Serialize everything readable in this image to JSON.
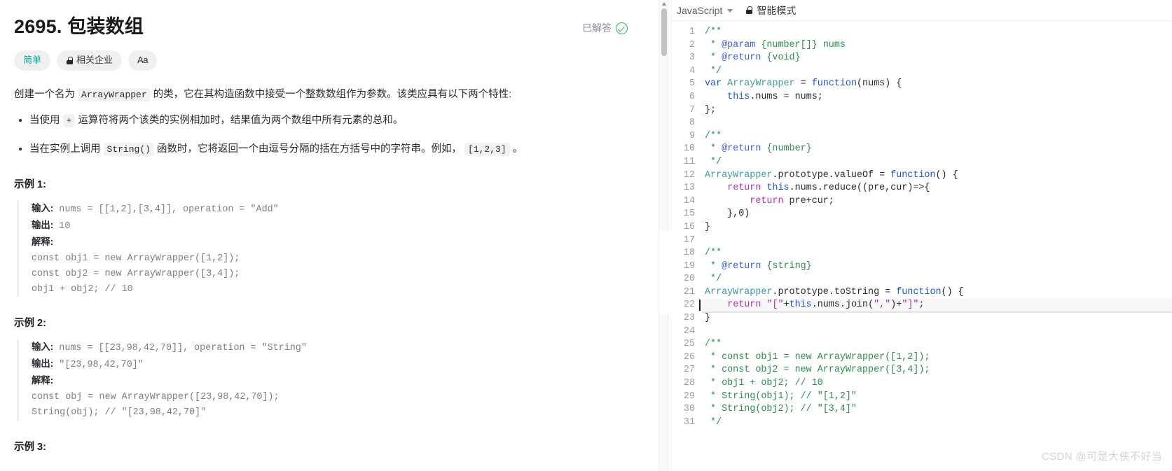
{
  "problem": {
    "title": "2695. 包装数组",
    "solved_label": "已解答",
    "tags": [
      {
        "label": "简单",
        "name": "difficulty-easy"
      },
      {
        "label": "相关企业",
        "name": "related-companies"
      },
      {
        "label": "Aa",
        "name": "font-size-toggle"
      }
    ],
    "description": {
      "intro_1": "创建一个名为 ",
      "intro_code": "ArrayWrapper",
      "intro_2": " 的类，它在其构造函数中接受一个整数数组作为参数。该类应具有以下两个特性:",
      "bullets": [
        {
          "part1": "当使用 ",
          "code1": "+",
          "part2": " 运算符将两个该类的实例相加时，结果值为两个数组中所有元素的总和。",
          "code2": "",
          "part3": ""
        },
        {
          "part1": "当在实例上调用 ",
          "code1": "String()",
          "part2": " 函数时，它将返回一个由逗号分隔的括在方括号中的字符串。例如， ",
          "code2": "[1,2,3]",
          "part3": " 。"
        }
      ]
    },
    "examples": [
      {
        "title": "示例 1:",
        "lines": [
          {
            "label": "输入:",
            "text": " nums = [[1,2],[3,4]], operation = \"Add\""
          },
          {
            "label": "输出:",
            "text": " 10"
          },
          {
            "label": "解释:",
            "text": ""
          },
          {
            "label": "",
            "text": "const obj1 = new ArrayWrapper([1,2]);"
          },
          {
            "label": "",
            "text": "const obj2 = new ArrayWrapper([3,4]);"
          },
          {
            "label": "",
            "text": "obj1 + obj2; // 10"
          }
        ]
      },
      {
        "title": "示例 2:",
        "lines": [
          {
            "label": "输入:",
            "text": " nums = [[23,98,42,70]], operation = \"String\""
          },
          {
            "label": "输出:",
            "text": " \"[23,98,42,70]\""
          },
          {
            "label": "解释:",
            "text": ""
          },
          {
            "label": "",
            "text": "const obj = new ArrayWrapper([23,98,42,70]);"
          },
          {
            "label": "",
            "text": "String(obj); // \"[23,98,42,70]\""
          }
        ]
      },
      {
        "title": "示例 3:",
        "lines": []
      }
    ]
  },
  "editor": {
    "language": "JavaScript",
    "smart_mode": "智能模式",
    "active_line": 22,
    "lines": [
      {
        "n": 1,
        "tokens": [
          {
            "t": "/**",
            "c": "cmt"
          }
        ]
      },
      {
        "n": 2,
        "tokens": [
          {
            "t": " * ",
            "c": "cmt"
          },
          {
            "t": "@param",
            "c": "cmt-tag"
          },
          {
            "t": " {number[]} nums",
            "c": "cmt"
          }
        ]
      },
      {
        "n": 3,
        "tokens": [
          {
            "t": " * ",
            "c": "cmt"
          },
          {
            "t": "@return",
            "c": "cmt-tag"
          },
          {
            "t": " {void}",
            "c": "cmt"
          }
        ]
      },
      {
        "n": 4,
        "tokens": [
          {
            "t": " */",
            "c": "cmt"
          }
        ]
      },
      {
        "n": 5,
        "tokens": [
          {
            "t": "var",
            "c": "kw"
          },
          {
            "t": " ",
            "c": "plain"
          },
          {
            "t": "ArrayWrapper",
            "c": "cls"
          },
          {
            "t": " = ",
            "c": "plain"
          },
          {
            "t": "function",
            "c": "fn"
          },
          {
            "t": "(nums) {",
            "c": "plain"
          }
        ]
      },
      {
        "n": 6,
        "tokens": [
          {
            "t": "    ",
            "c": "plain"
          },
          {
            "t": "this",
            "c": "kw"
          },
          {
            "t": ".nums = nums;",
            "c": "plain"
          }
        ]
      },
      {
        "n": 7,
        "tokens": [
          {
            "t": "};",
            "c": "plain"
          }
        ]
      },
      {
        "n": 8,
        "tokens": []
      },
      {
        "n": 9,
        "tokens": [
          {
            "t": "/**",
            "c": "cmt"
          }
        ]
      },
      {
        "n": 10,
        "tokens": [
          {
            "t": " * ",
            "c": "cmt"
          },
          {
            "t": "@return",
            "c": "cmt-tag"
          },
          {
            "t": " {number}",
            "c": "cmt"
          }
        ]
      },
      {
        "n": 11,
        "tokens": [
          {
            "t": " */",
            "c": "cmt"
          }
        ]
      },
      {
        "n": 12,
        "tokens": [
          {
            "t": "ArrayWrapper",
            "c": "cls"
          },
          {
            "t": ".prototype.valueOf = ",
            "c": "plain"
          },
          {
            "t": "function",
            "c": "fn"
          },
          {
            "t": "() {",
            "c": "plain"
          }
        ]
      },
      {
        "n": 13,
        "tokens": [
          {
            "t": "    ",
            "c": "plain"
          },
          {
            "t": "return",
            "c": "kw2"
          },
          {
            "t": " ",
            "c": "plain"
          },
          {
            "t": "this",
            "c": "kw"
          },
          {
            "t": ".nums.reduce((pre,cur)=>{",
            "c": "plain"
          }
        ]
      },
      {
        "n": 14,
        "tokens": [
          {
            "t": "        ",
            "c": "plain"
          },
          {
            "t": "return",
            "c": "kw2"
          },
          {
            "t": " pre+cur;",
            "c": "plain"
          }
        ]
      },
      {
        "n": 15,
        "tokens": [
          {
            "t": "    },0)",
            "c": "plain"
          }
        ]
      },
      {
        "n": 16,
        "tokens": [
          {
            "t": "}",
            "c": "plain"
          }
        ]
      },
      {
        "n": 17,
        "tokens": []
      },
      {
        "n": 18,
        "tokens": [
          {
            "t": "/**",
            "c": "cmt"
          }
        ]
      },
      {
        "n": 19,
        "tokens": [
          {
            "t": " * ",
            "c": "cmt"
          },
          {
            "t": "@return",
            "c": "cmt-tag"
          },
          {
            "t": " {string}",
            "c": "cmt"
          }
        ]
      },
      {
        "n": 20,
        "tokens": [
          {
            "t": " */",
            "c": "cmt"
          }
        ]
      },
      {
        "n": 21,
        "tokens": [
          {
            "t": "ArrayWrapper",
            "c": "cls"
          },
          {
            "t": ".prototype.toString = ",
            "c": "plain"
          },
          {
            "t": "function",
            "c": "fn"
          },
          {
            "t": "() {",
            "c": "plain"
          }
        ]
      },
      {
        "n": 22,
        "tokens": [
          {
            "t": "    ",
            "c": "plain"
          },
          {
            "t": "return",
            "c": "kw2"
          },
          {
            "t": " ",
            "c": "plain"
          },
          {
            "t": "\"[\"",
            "c": "str"
          },
          {
            "t": "+",
            "c": "plain"
          },
          {
            "t": "this",
            "c": "kw"
          },
          {
            "t": ".nums.join(",
            "c": "plain"
          },
          {
            "t": "\",\"",
            "c": "str"
          },
          {
            "t": ")+",
            "c": "plain"
          },
          {
            "t": "\"]\"",
            "c": "str"
          },
          {
            "t": ";",
            "c": "plain"
          }
        ]
      },
      {
        "n": 23,
        "tokens": [
          {
            "t": "}",
            "c": "plain"
          }
        ]
      },
      {
        "n": 24,
        "tokens": []
      },
      {
        "n": 25,
        "tokens": [
          {
            "t": "/**",
            "c": "cmt"
          }
        ]
      },
      {
        "n": 26,
        "tokens": [
          {
            "t": " * const obj1 = new ArrayWrapper([1,2]);",
            "c": "cmt"
          }
        ]
      },
      {
        "n": 27,
        "tokens": [
          {
            "t": " * const obj2 = new ArrayWrapper([3,4]);",
            "c": "cmt"
          }
        ]
      },
      {
        "n": 28,
        "tokens": [
          {
            "t": " * obj1 + obj2; // 10",
            "c": "cmt"
          }
        ]
      },
      {
        "n": 29,
        "tokens": [
          {
            "t": " * String(obj1); // \"[1,2]\"",
            "c": "cmt"
          }
        ]
      },
      {
        "n": 30,
        "tokens": [
          {
            "t": " * String(obj2); // \"[3,4]\"",
            "c": "cmt"
          }
        ]
      },
      {
        "n": 31,
        "tokens": [
          {
            "t": " */",
            "c": "cmt"
          }
        ]
      }
    ]
  },
  "watermark": "CSDN @可是大侠不好当",
  "colors": {
    "easy": "#00af9b",
    "solved_check": "#2db55d",
    "comment": "#2a8f4e",
    "keyword": "#1a56d6",
    "return_keyword": "#b32fb3",
    "class_name": "#3a9b9b"
  }
}
